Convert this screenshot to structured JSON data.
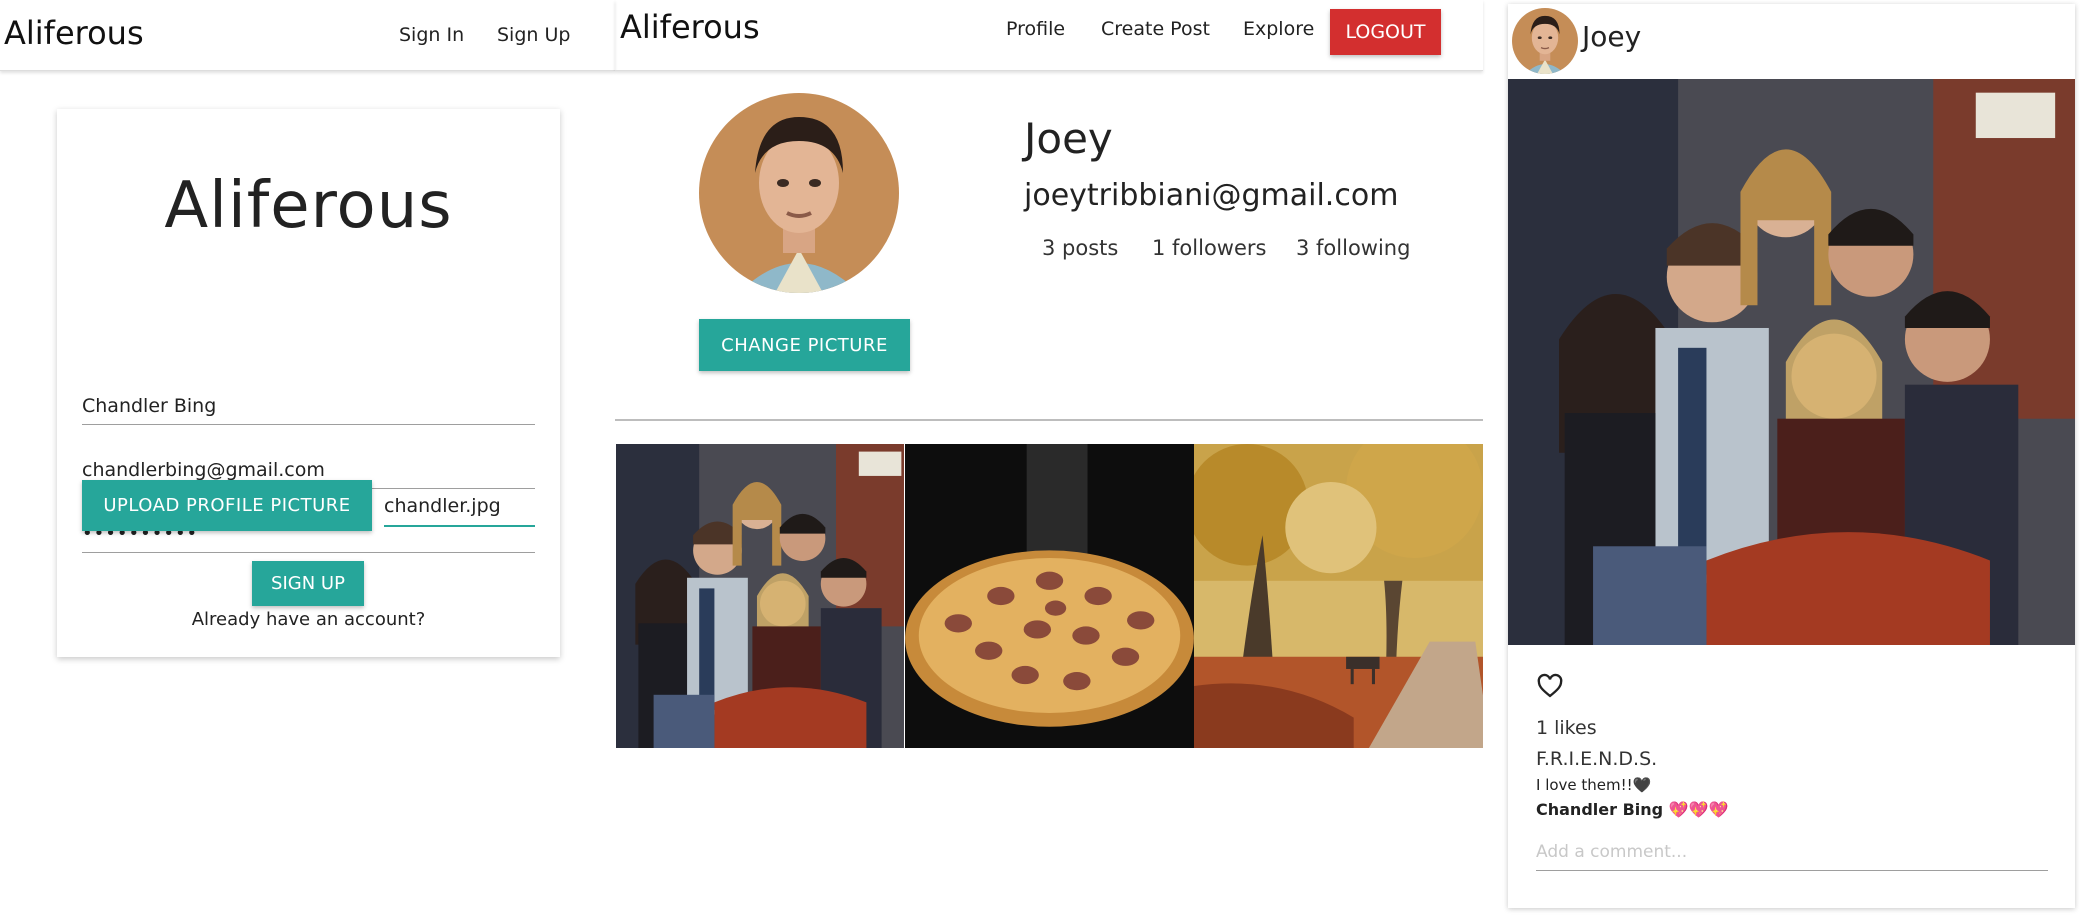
{
  "signup": {
    "brand": "Aliferous",
    "nav": {
      "sign_in": "Sign In",
      "sign_up": "Sign Up"
    },
    "card_title": "Aliferous",
    "name_value": "Chandler Bing",
    "email_value": "chandlerbing@gmail.com",
    "password_mask": "••••••••••",
    "upload_label": "UPLOAD PROFILE PICTURE",
    "file_name": "chandler.jpg",
    "submit_label": "SIGN UP",
    "already_text": "Already have an account?"
  },
  "profile": {
    "brand": "Aliferous",
    "nav": {
      "profile": "Profile",
      "create_post": "Create Post",
      "explore": "Explore",
      "logout": "LOGOUT"
    },
    "name": "Joey",
    "email": "joeytribbiani@gmail.com",
    "stats": {
      "posts": "3 posts",
      "followers": "1 followers",
      "following": "3 following"
    },
    "change_picture_label": "CHANGE PICTURE",
    "gallery": [
      "friends-group-photo",
      "pepperoni-pizza-photo",
      "autumn-park-photo"
    ]
  },
  "post": {
    "username": "Joey",
    "likes": "1 likes",
    "caption": "F.R.I.E.N.D.S.",
    "comment_text": "I love them!!🖤",
    "comment_user": "Chandler Bing",
    "comment_emoji": "💖💖💖",
    "comment_placeholder": "Add a comment..."
  },
  "colors": {
    "teal": "#26a69a",
    "logout_red": "#d32f2f"
  }
}
